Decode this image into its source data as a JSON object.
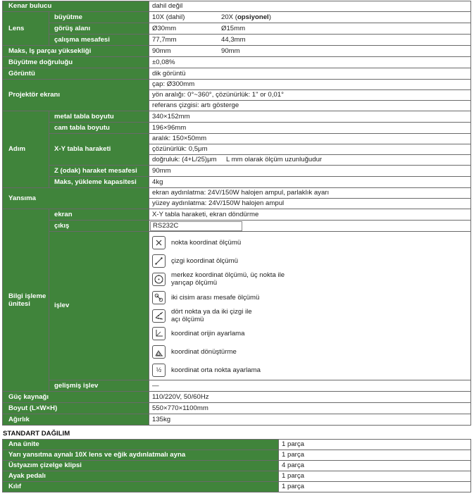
{
  "spec": {
    "kenar_bulucu": {
      "label": "Kenar bulucu",
      "value": "dahil değil"
    },
    "lens": {
      "label": "Lens",
      "buyutme": {
        "label": "büyütme",
        "v1": "10X (dahil)",
        "v2_pre": "20X (",
        "v2_bold": "opsiyonel",
        "v2_post": ")"
      },
      "gorus": {
        "label": "görüş alanı",
        "v1": "Ø30mm",
        "v2": "Ø15mm"
      },
      "calisma": {
        "label": "çalışma mesafesi",
        "v1": "77,7mm",
        "v2": "44,3mm"
      }
    },
    "maks_yukseklik": {
      "label": "Maks, Iş parçaı yüksekliği",
      "v1": "90mm",
      "v2": "90mm"
    },
    "dogruluk": {
      "label": "Büyütme doğruluğu",
      "value": "±0,08%"
    },
    "goruntu": {
      "label": "Görüntü",
      "value": "dik görüntü"
    },
    "projektor": {
      "label": "Projektör ekranı",
      "lines": [
        "çap: Ø300mm",
        "yön aralığı: 0°~360°, çözünürlük: 1\" or 0,01°",
        "referans çizgisi: artı gösterge"
      ]
    },
    "adim": {
      "label": "Adım",
      "metal": {
        "label": "metal tabla boyutu",
        "value": "340×152mm"
      },
      "cam": {
        "label": "cam tabla boyutu",
        "value": "196×96mm"
      },
      "xy": {
        "label": "X-Y tabla haraketi",
        "lines": [
          "aralık: 150×50mm",
          "çözünürlük: 0,5μm",
          "doğruluk: (4+L/25)μm     L mm olarak ölçüm uzunluğudur"
        ]
      },
      "z": {
        "label": "Z (odak) haraket mesafesi",
        "value": "90mm"
      },
      "yuk": {
        "label": "Maks, yükleme kapasitesi",
        "value": "4kg"
      }
    },
    "yansima": {
      "label": "Yansıma",
      "lines": [
        "ekran aydınlatma: 24V/150W halojen ampul, parlaklık ayarı",
        "yüzey aydınlatma: 24V/150W halojen ampul"
      ]
    },
    "bilgi": {
      "label": "Bilgi işleme ünitesi",
      "ekran": {
        "label": "ekran",
        "value": "X-Y tabla haraketi, ekran döndürme"
      },
      "cikis": {
        "label": "çıkış",
        "value": "RS232C"
      },
      "islev": {
        "label": "işlev",
        "items": [
          {
            "text": "nokta koordinat ölçümü",
            "icon": "cross-point-icon"
          },
          {
            "text": "çizgi koordinat ölçümü",
            "icon": "line-icon"
          },
          {
            "text": "merkez koordinat ölçümü, üç nokta ile yarıçap ölçümü",
            "icon": "circle-center-icon"
          },
          {
            "text": "iki cisim arası mesafe ölçümü",
            "icon": "distance-icon"
          },
          {
            "text": "dört nokta ya da iki çizgi ile açı ölçümü",
            "icon": "angle-icon"
          },
          {
            "text": "koordinat orijin ayarlama",
            "icon": "origin-icon"
          },
          {
            "text": "koordinat dönüştürme",
            "icon": "transform-icon"
          },
          {
            "text": "koordinat orta nokta ayarlama",
            "icon": "half-icon",
            "glyph": "½"
          }
        ]
      },
      "gelismis": {
        "label": "gelişmiş işlev",
        "value": "—"
      }
    },
    "guc": {
      "label": "Güç kaynağı",
      "value": "110/220V, 50/60Hz"
    },
    "boyut": {
      "label": "Boyut (L×W×H)",
      "value": "550×770×1100mm"
    },
    "agirlik": {
      "label": "Ağırlık",
      "value": "135kg"
    }
  },
  "standart": {
    "title": "STANDART DAĞILIM",
    "rows": [
      {
        "item": "Ana ünite",
        "qty": "1 parça"
      },
      {
        "item": "Yarı yansıtma aynalı 10X lens ve eğik aydınlatmalı ayna",
        "qty": "1 parça"
      },
      {
        "item": "Üstyazım çizelge klipsi",
        "qty": "4 parça"
      },
      {
        "item": "Ayak pedalı",
        "qty": "1 parça"
      },
      {
        "item": "Kılıf",
        "qty": "1 parça"
      }
    ]
  }
}
